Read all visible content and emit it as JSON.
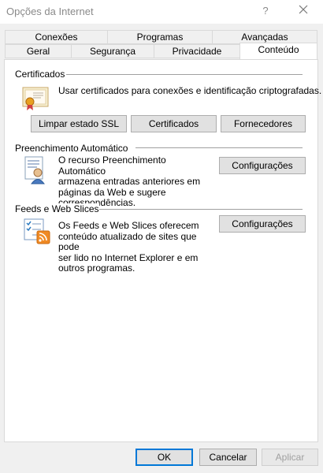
{
  "window": {
    "title": "Opções da Internet",
    "help_glyph": "?"
  },
  "tabs": {
    "row_back": [
      "Conexões",
      "Programas",
      "Avançadas"
    ],
    "row_front": [
      "Geral",
      "Segurança",
      "Privacidade",
      "Conteúdo"
    ],
    "active": "Conteúdo"
  },
  "certificates": {
    "heading": "Certificados",
    "description": "Usar certificados para conexões e identificação criptografadas.",
    "buttons": {
      "clear_ssl": "Limpar estado SSL",
      "certificates": "Certificados",
      "publishers": "Fornecedores"
    }
  },
  "autocomplete": {
    "heading": "Preenchimento Automático",
    "description_lines": [
      "O recurso Preenchimento Automático",
      "armazena entradas anteriores em",
      "páginas da Web e sugere",
      "correspondências."
    ],
    "settings_label": "Configurações"
  },
  "feeds": {
    "heading": "Feeds e Web Slices",
    "description_lines": [
      "Os Feeds e Web Slices oferecem",
      "conteúdo atualizado de sites que pode",
      "ser lido no Internet Explorer e em",
      "outros programas."
    ],
    "settings_label": "Configurações"
  },
  "footer": {
    "ok": "OK",
    "cancel": "Cancelar",
    "apply": "Aplicar"
  }
}
